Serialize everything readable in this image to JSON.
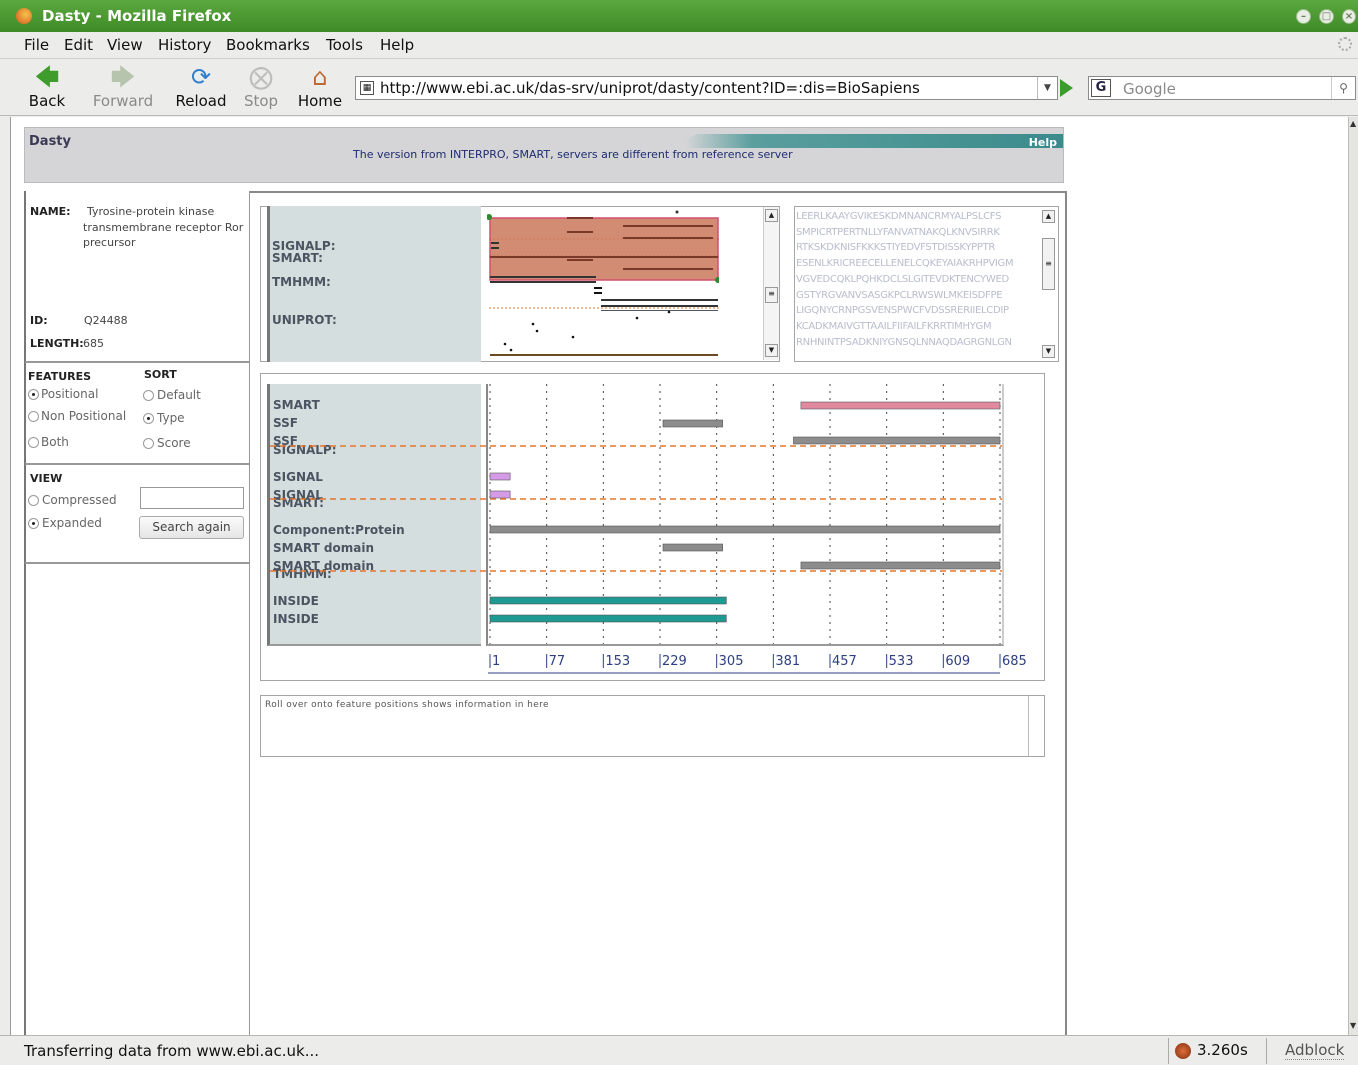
{
  "window": {
    "title": "Dasty - Mozilla Firefox"
  },
  "menu": [
    "File",
    "Edit",
    "View",
    "History",
    "Bookmarks",
    "Tools",
    "Help"
  ],
  "toolbar": {
    "back": "Back",
    "forward": "Forward",
    "reload": "Reload",
    "stop": "Stop",
    "home": "Home"
  },
  "address": {
    "url": "http://www.ebi.ac.uk/das-srv/uniprot/dasty/content?ID=:dis=BioSapiens"
  },
  "search": {
    "engine_letter": "G",
    "placeholder": "Google"
  },
  "dasty": {
    "title": "Dasty",
    "help": "Help",
    "message": "The version from INTERPRO, SMART,  servers are different from reference server"
  },
  "protein": {
    "name_label": "NAME:",
    "name": "Tyrosine-protein kinase transmembrane receptor Ror precursor",
    "name_line1": "Tyrosine-protein kinase",
    "name_line2": "transmembrane receptor Ror",
    "name_line3": "precursor",
    "id_label": "ID:",
    "id": "Q24488",
    "length_label": "LENGTH:",
    "length": "685"
  },
  "controls": {
    "features_label": "FEATURES",
    "sort_label": "SORT",
    "view_label": "VIEW",
    "features": [
      {
        "label": "Positional",
        "selected": true
      },
      {
        "label": "Non Positional",
        "selected": false
      },
      {
        "label": "Both",
        "selected": false
      }
    ],
    "sort": [
      {
        "label": "Default",
        "selected": false
      },
      {
        "label": "Type",
        "selected": true
      },
      {
        "label": "Score",
        "selected": false
      }
    ],
    "view": [
      {
        "label": "Compressed",
        "selected": false
      },
      {
        "label": "Expanded",
        "selected": true
      }
    ],
    "search_again": "Search again"
  },
  "overview": {
    "labels": [
      "SIGNALP:",
      "SMART:",
      "TMHMM:",
      "UNIPROT:"
    ]
  },
  "sequence": {
    "lines": [
      "LEERLKAAYGVIKESKDMNANCRMYALPSLCFS",
      "SMPICRTPERTNLLYFANVATNAKQLKNVSIRRK",
      "RTKSKDKNISFKKKSTIYEDVFSTDISSKYPPTR",
      "ESENLKRICREECELLENELCQKEYAIAKRHPVIGM",
      "VGVEDCQKLPQHKDCLSLGITEVDKTENCYWED",
      "GSTYRGVANVSASGKPCLRWSWLMKEISDFPE",
      "LIGQNYCRNPGSVENSPWCFVDSSRERIIELCDIP",
      "KCADKMAIVGTTAAILFIIFAILFKRRTIMHYGM",
      "RNHNINTPSADKNIYGNSQLNNAQDAGRGNLGN"
    ]
  },
  "detail": {
    "groups": [
      {
        "source": "SIGNALP:",
        "features": [
          "SMART",
          "SSF",
          "SSF"
        ]
      },
      {
        "source": "SMART:",
        "features": [
          "SIGNAL",
          "SIGNAL"
        ]
      },
      {
        "source": "TMHMM:",
        "features": [
          "Component:Protein",
          "SMART domain",
          "SMART domain"
        ]
      },
      {
        "source": "",
        "features": [
          "INSIDE",
          "INSIDE"
        ]
      }
    ],
    "ticks": [
      "1",
      "77",
      "153",
      "229",
      "305",
      "381",
      "457",
      "533",
      "609",
      "685"
    ],
    "tracks": [
      {
        "label": "SMART",
        "start": 418,
        "end": 685,
        "color": "#e08aa0"
      },
      {
        "label": "SSF",
        "start": 233,
        "end": 313,
        "color": "#8c8c8c"
      },
      {
        "label": "SSF",
        "start": 408,
        "end": 685,
        "color": "#8c8c8c"
      },
      {
        "label": "SIGNAL",
        "start": 1,
        "end": 28,
        "color": "#d59be6"
      },
      {
        "label": "SIGNAL",
        "start": 1,
        "end": 28,
        "color": "#d59be6"
      },
      {
        "label": "Component:Protein",
        "start": 1,
        "end": 685,
        "color": "#8c8c8c"
      },
      {
        "label": "SMART domain",
        "start": 233,
        "end": 313,
        "color": "#8c8c8c"
      },
      {
        "label": "SMART domain",
        "start": 418,
        "end": 685,
        "color": "#8c8c8c"
      },
      {
        "label": "INSIDE",
        "start": 1,
        "end": 318,
        "color": "#1e9a92"
      },
      {
        "label": "INSIDE",
        "start": 1,
        "end": 318,
        "color": "#1e9a92"
      }
    ]
  },
  "info": {
    "text": "Roll over onto feature positions shows information in here"
  },
  "status": {
    "text": "Transferring data from www.ebi.ac.uk...",
    "timer": "3.260s",
    "adblock": "Adblock"
  }
}
